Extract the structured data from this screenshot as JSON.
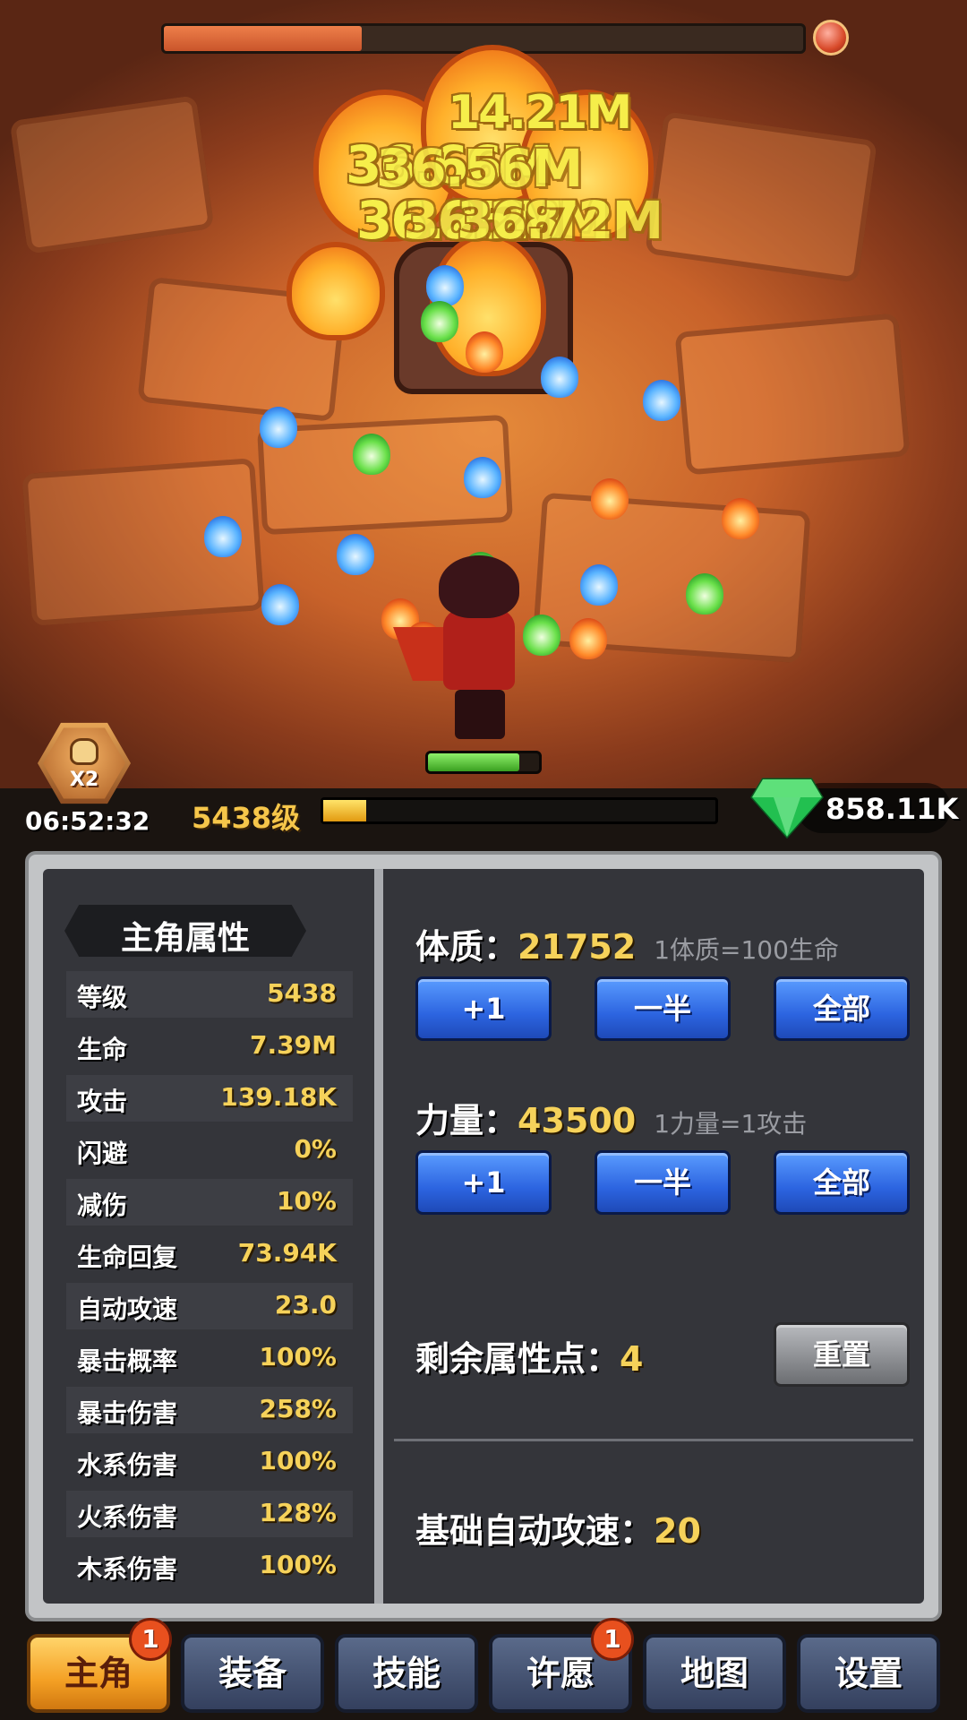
{
  "battle": {
    "boss_hp_fraction": 0.31,
    "hero_hp_fraction": 0.82,
    "damage_numbers": [
      "14.21M",
      "36.66M",
      "36.56M",
      "36.25M",
      "36.28M",
      "36.72M"
    ]
  },
  "status": {
    "boost_label": "X2",
    "timer": "06:52:32",
    "level": "5438级",
    "xp_fraction": 0.11,
    "gems": "858.11K"
  },
  "left_panel": {
    "title": "主角属性",
    "stats": [
      {
        "label": "等级",
        "value": "5438"
      },
      {
        "label": "生命",
        "value": "7.39M"
      },
      {
        "label": "攻击",
        "value": "139.18K"
      },
      {
        "label": "闪避",
        "value": "0%"
      },
      {
        "label": "减伤",
        "value": "10%"
      },
      {
        "label": "生命回复",
        "value": "73.94K"
      },
      {
        "label": "自动攻速",
        "value": "23.0"
      },
      {
        "label": "暴击概率",
        "value": "100%"
      },
      {
        "label": "暴击伤害",
        "value": "258%"
      },
      {
        "label": "水系伤害",
        "value": "100%"
      },
      {
        "label": "火系伤害",
        "value": "128%"
      },
      {
        "label": "木系伤害",
        "value": "100%"
      }
    ]
  },
  "right_panel": {
    "constitution": {
      "label": "体质：",
      "value": "21752",
      "note": "1体质=100生命"
    },
    "strength": {
      "label": "力量：",
      "value": "43500",
      "note": "1力量=1攻击"
    },
    "buttons": {
      "plus_one": "+1",
      "half": "一半",
      "all": "全部",
      "reset": "重置"
    },
    "remaining": {
      "label": "剩余属性点：",
      "value": "4"
    },
    "base_speed": {
      "label": "基础自动攻速：",
      "value": "20"
    }
  },
  "nav": {
    "tabs": [
      {
        "label": "主角",
        "badge": "1"
      },
      {
        "label": "装备",
        "badge": ""
      },
      {
        "label": "技能",
        "badge": ""
      },
      {
        "label": "许愿",
        "badge": "1"
      },
      {
        "label": "地图",
        "badge": ""
      },
      {
        "label": "设置",
        "badge": ""
      }
    ]
  },
  "colors": {
    "accent_gold": "#f6d25a",
    "button_blue": "#2c64e0",
    "tab_active": "#f4a024"
  }
}
